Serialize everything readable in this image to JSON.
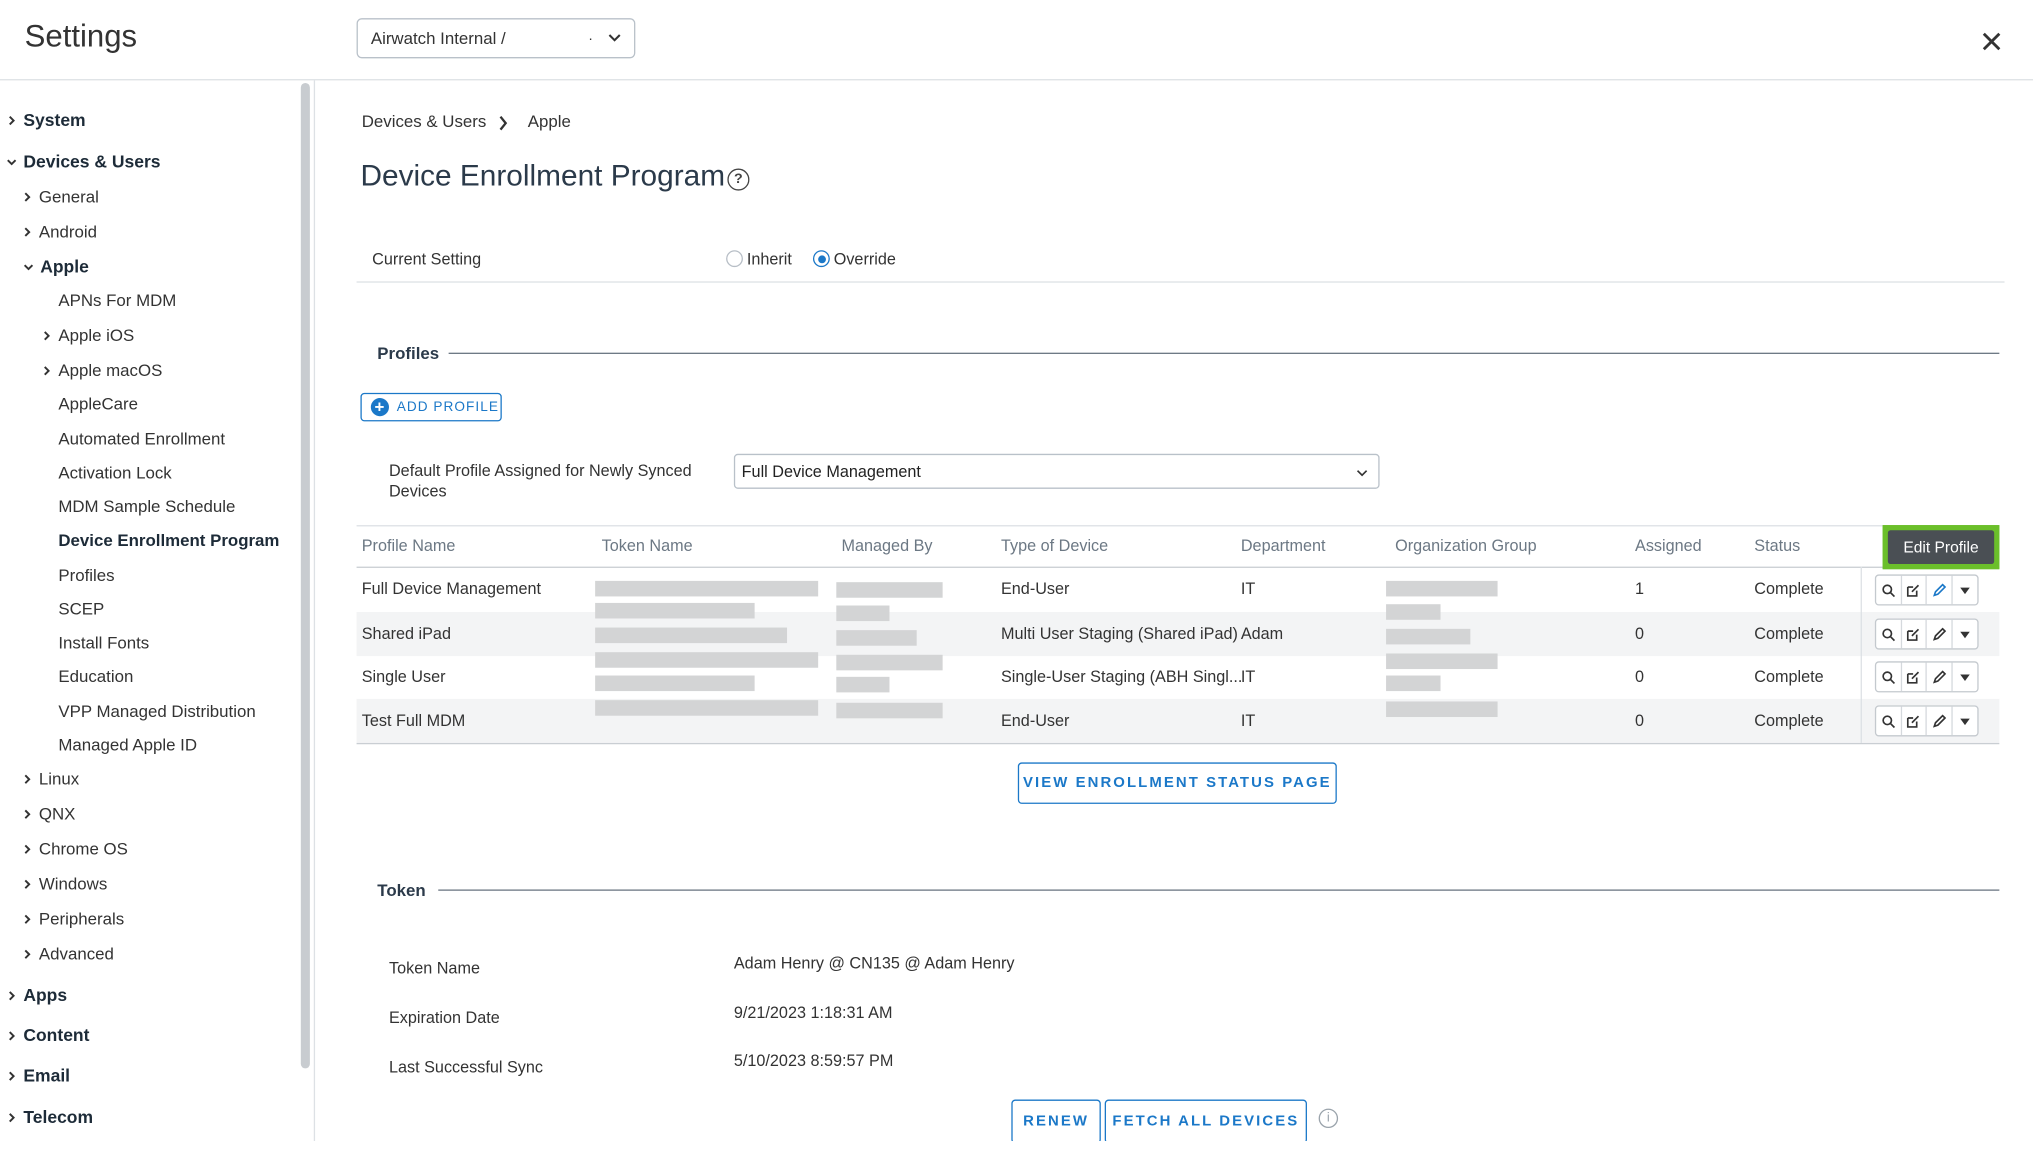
{
  "header": {
    "title": "Settings",
    "org_group": "Airwatch Internal /",
    "org_group_suffix": "."
  },
  "sidebar": {
    "items": [
      {
        "label": "System"
      },
      {
        "label": "Devices & Users"
      },
      {
        "label": "General"
      },
      {
        "label": "Android"
      },
      {
        "label": "Apple"
      },
      {
        "label": "APNs For MDM"
      },
      {
        "label": "Apple iOS"
      },
      {
        "label": "Apple macOS"
      },
      {
        "label": "AppleCare"
      },
      {
        "label": "Automated Enrollment"
      },
      {
        "label": "Activation Lock"
      },
      {
        "label": "MDM Sample Schedule"
      },
      {
        "label": "Device Enrollment Program"
      },
      {
        "label": "Profiles"
      },
      {
        "label": "SCEP"
      },
      {
        "label": "Install Fonts"
      },
      {
        "label": "Education"
      },
      {
        "label": "VPP Managed Distribution"
      },
      {
        "label": "Managed Apple ID"
      },
      {
        "label": "Linux"
      },
      {
        "label": "QNX"
      },
      {
        "label": "Chrome OS"
      },
      {
        "label": "Windows"
      },
      {
        "label": "Peripherals"
      },
      {
        "label": "Advanced"
      },
      {
        "label": "Apps"
      },
      {
        "label": "Content"
      },
      {
        "label": "Email"
      },
      {
        "label": "Telecom"
      }
    ]
  },
  "breadcrumb": [
    "Devices & Users",
    "Apple"
  ],
  "page": {
    "title": "Device Enrollment Program",
    "current_setting_label": "Current Setting",
    "inherit_label": "Inherit",
    "override_label": "Override",
    "selected": "Override"
  },
  "profiles": {
    "section_title": "Profiles",
    "add_button": "ADD PROFILE",
    "default_profile_label": "Default Profile Assigned for Newly Synced Devices",
    "default_profile_value": "Full Device Management",
    "columns": [
      "Profile Name",
      "Token Name",
      "Managed By",
      "Type of Device",
      "Department",
      "Organization Group",
      "Assigned",
      "Status"
    ],
    "rows": [
      {
        "name": "Full Device Management",
        "type": "End-User",
        "department": "IT",
        "assigned": "1",
        "status": "Complete"
      },
      {
        "name": "Shared iPad",
        "type": "Multi User Staging (Shared iPad)",
        "department": "Adam",
        "assigned": "0",
        "status": "Complete"
      },
      {
        "name": "Single User",
        "type": "Single-User Staging (ABH Singl...",
        "department": "IT",
        "assigned": "0",
        "status": "Complete"
      },
      {
        "name": "Test Full MDM",
        "type": "End-User",
        "department": "IT",
        "assigned": "0",
        "status": "Complete"
      }
    ],
    "tooltip": "Edit Profile",
    "view_status_button": "VIEW ENROLLMENT STATUS PAGE"
  },
  "token": {
    "section_title": "Token",
    "fields": [
      {
        "label": "Token Name",
        "value": "Adam Henry @ CN135 @ Adam Henry"
      },
      {
        "label": "Expiration Date",
        "value": "9/21/2023 1:18:31 AM"
      },
      {
        "label": "Last Successful Sync",
        "value": "5/10/2023 8:59:57 PM"
      }
    ],
    "renew_button": "RENEW",
    "fetch_button": "FETCH ALL DEVICES"
  },
  "colors": {
    "accent": "#1b78c8",
    "highlight": "#6bbf2a",
    "tooltip_bg": "#4a4f54"
  },
  "icons": [
    "chevron-down-icon",
    "close-icon",
    "help-icon",
    "plus-circle-icon",
    "search-icon",
    "edit-icon",
    "pencil-icon",
    "caret-down-icon",
    "info-icon"
  ]
}
